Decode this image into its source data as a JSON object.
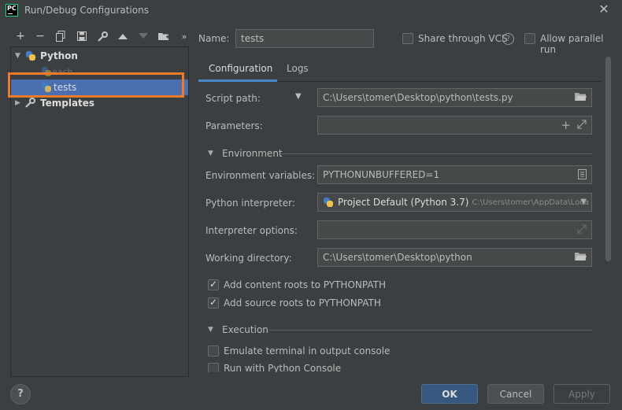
{
  "window": {
    "title": "Run/Debug Configurations",
    "app_icon": "PC"
  },
  "toolbar": {
    "icons": [
      "add-icon",
      "remove-icon",
      "copy-icon",
      "save-icon",
      "wrench-icon",
      "move-up-icon",
      "move-down-icon",
      "folder-add-icon",
      "more-icon"
    ]
  },
  "tree": {
    "python_label": "Python",
    "each_label": "each",
    "tests_label": "tests",
    "templates_label": "Templates"
  },
  "header": {
    "name_label": "Name:",
    "name_value": "tests",
    "share_label": "Share through VCS",
    "parallel_label": "Allow parallel run"
  },
  "tabs": [
    {
      "label": "Configuration",
      "active": true
    },
    {
      "label": "Logs",
      "active": false
    }
  ],
  "form": {
    "script_path_label": "Script path:",
    "script_path_value": "C:\\Users\\tomer\\Desktop\\python\\tests.py",
    "parameters_label": "Parameters:",
    "environment_section": "Environment",
    "env_vars_label": "Environment variables:",
    "env_vars_value": "PYTHONUNBUFFERED=1",
    "interpreter_label": "Python interpreter:",
    "interpreter_value": "Project Default (Python 3.7)",
    "interpreter_path": "C:\\Users\\tomer\\AppData\\Loca",
    "interp_options_label": "Interpreter options:",
    "working_dir_label": "Working directory:",
    "working_dir_value": "C:\\Users\\tomer\\Desktop\\python",
    "content_roots_label": "Add content roots to PYTHONPATH",
    "source_roots_label": "Add source roots to PYTHONPATH",
    "execution_section": "Execution",
    "emulate_terminal_label": "Emulate terminal in output console",
    "python_console_label": "Run with Python Console"
  },
  "footer": {
    "help_label": "?",
    "ok_label": "OK",
    "cancel_label": "Cancel",
    "apply_label": "Apply"
  },
  "colors": {
    "background": "#3c3f41",
    "selection": "#4b6eaf",
    "highlight_box": "#ec7a2b",
    "primary_button": "#365880",
    "tab_underline": "#4a88c7"
  }
}
